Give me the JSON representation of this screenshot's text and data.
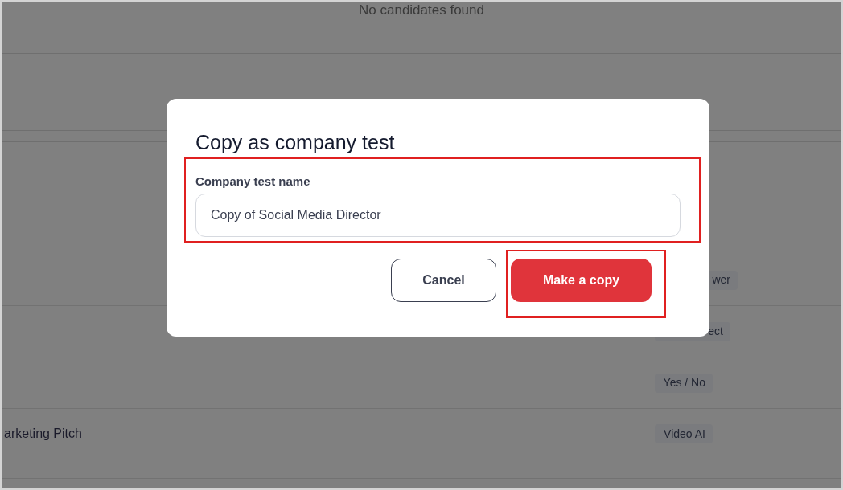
{
  "background": {
    "empty_message": "No candidates found",
    "rows": [
      {
        "tag": "wer"
      },
      {
        "tag": "ect"
      },
      {
        "tag": "Yes / No"
      },
      {
        "name": "arketing Pitch",
        "tag": "Video AI"
      }
    ]
  },
  "dialog": {
    "title": "Copy as company test",
    "field": {
      "label": "Company test name",
      "value": "Copy of Social Media Director",
      "highlighted": true
    },
    "buttons": [
      {
        "label": "Cancel",
        "kind": "secondary",
        "highlighted": false
      },
      {
        "label": "Make a copy",
        "kind": "primary",
        "highlighted": true
      }
    ]
  }
}
